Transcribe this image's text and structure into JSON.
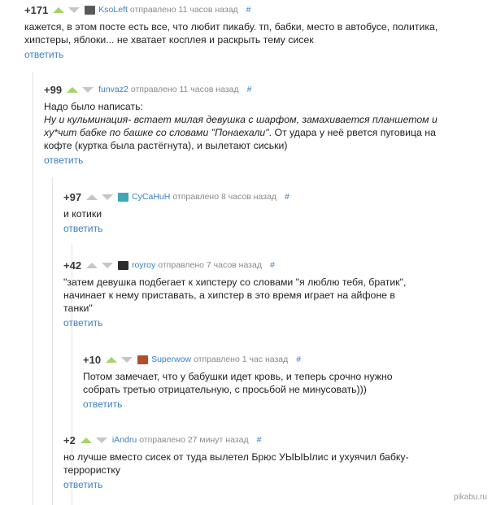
{
  "comments": [
    {
      "rating": "+171",
      "username": "KsoLeft",
      "sent_text": "отправлено 11 часов назад",
      "hash": "#",
      "lines": [
        "кажется, в этом посте есть все, что любит пикабу. тп, бабки, место в автобусе, политика,",
        "хипстеры, яблоки... не хватает косплея и раскрыть тему сисек"
      ],
      "reply_label": "ответить",
      "avatar_color": "#5a5a5a"
    },
    {
      "rating": "+99",
      "username": "funvaz2",
      "sent_text": "отправлено 11 часов назад",
      "hash": "#",
      "lines_plain": [
        "Надо было написать:"
      ],
      "lines_italic": [
        "Ну и кульминация- встает милая девушка с шарфом, замахивается планшетом и",
        "ху*чит бабке по башке со словами \"Понаехали\""
      ],
      "italic_tail": ". От удара у неё рвется пуговица на",
      "lines_after": [
        "кофте (куртка была растёгнута), и вылетают сиськи)"
      ],
      "reply_label": "ответить"
    },
    {
      "rating": "+97",
      "username": "CyCaHuH",
      "sent_text": "отправлено 8 часов назад",
      "hash": "#",
      "lines": [
        "и котики"
      ],
      "reply_label": "ответить",
      "avatar_color": "#3fa6b8"
    },
    {
      "rating": "+42",
      "username": "royroy",
      "sent_text": "отправлено 7 часов назад",
      "hash": "#",
      "lines": [
        "\"затем девушка подбегает к хипстеру со словами \"я люблю тебя, братик\",",
        "начинает к нему приставать, а хипстер в это время играет на айфоне в",
        "танки\""
      ],
      "reply_label": "ответить",
      "avatar_color": "#2d2d2d"
    },
    {
      "rating": "+10",
      "username": "Superwow",
      "sent_text": "отправлено 1 час назад",
      "hash": "#",
      "lines": [
        "Потом замечает, что у бабушки идет кровь, и теперь срочно нужно",
        "собрать третью отрицательную, с просьбой не минусовать)))"
      ],
      "reply_label": "ответить",
      "avatar_color": "#b0502a"
    },
    {
      "rating": "+2",
      "username": "iAndru",
      "sent_text": "отправлено 27 минут назад",
      "hash": "#",
      "lines": [
        "но лучше вместо сисек от туда вылетел Брюс УЫЫЫлис и ухуячил бабку-",
        "террористку"
      ],
      "reply_label": "ответить"
    }
  ],
  "watermark": "pikabu.ru",
  "colors": {
    "link": "#3b80c4",
    "vote_up": "#a6d36a",
    "vote_down": "#c6c6c6",
    "thread_line": "#e3e3e3"
  }
}
